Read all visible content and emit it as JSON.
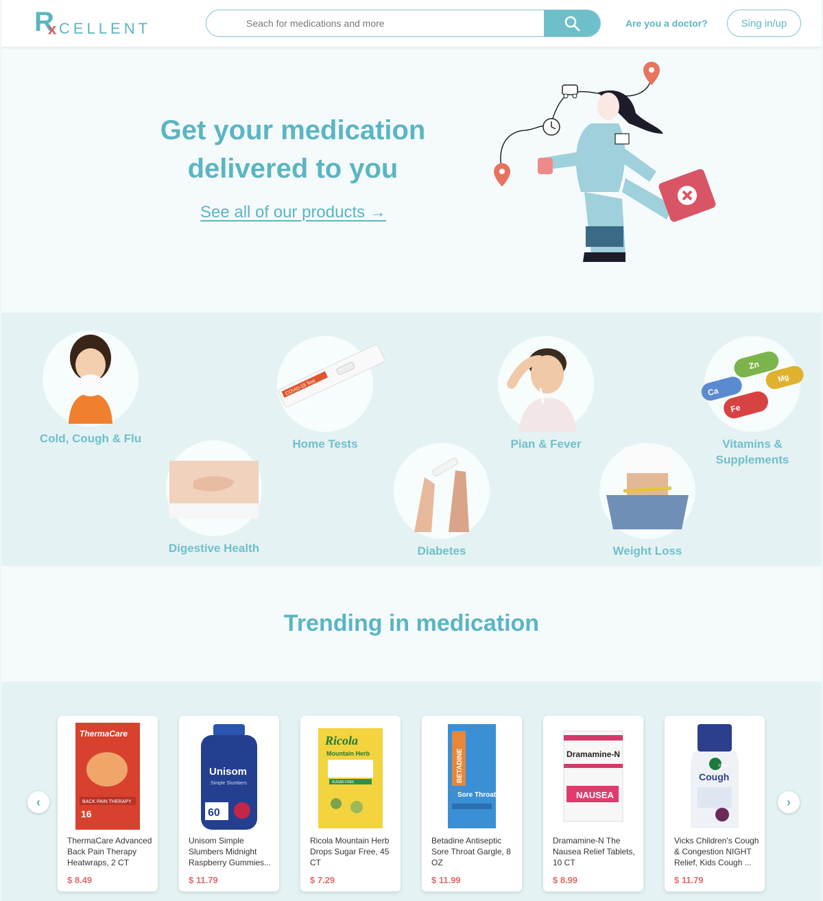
{
  "header": {
    "logo_r": "R",
    "logo_x": "x",
    "logo_rest": "CELLENT",
    "search_placeholder": "Seach for medications and more",
    "doctor_link": "Are you a doctor?",
    "signin_label": "Sing in/up"
  },
  "hero": {
    "title_line1": "Get your medication",
    "title_line2": "delivered to you",
    "cta": "See all of our products →"
  },
  "categories": [
    {
      "label": "Cold, Cough & Flu"
    },
    {
      "label": "Home Tests"
    },
    {
      "label": "Pian & Fever"
    },
    {
      "label": "Vitamins & Supplements"
    },
    {
      "label": "Digestive Health"
    },
    {
      "label": "Diabetes"
    },
    {
      "label": "Weight Loss"
    }
  ],
  "home_test_label": "COVID-19 Test",
  "vitamin_labels": [
    "Ca",
    "Zn",
    "Fe",
    "Mg"
  ],
  "trending": {
    "title": "Trending in medication",
    "products": [
      {
        "name": "ThermaCare Advanced Back Pain Therapy Heatwraps, 2 CT",
        "price": "$ 8.49",
        "brand": "ThermaCare",
        "sub": "BACK PAIN THERAPY",
        "count": "16"
      },
      {
        "name": "Unisom Simple Slumbers Midnight Raspberry Gummies...",
        "price": "$ 11.79",
        "brand": "Unisom",
        "sub": "Simple Slumbers",
        "count": "60"
      },
      {
        "name": "Ricola Mountain Herb Drops Sugar Free, 45 CT",
        "price": "$ 7.29",
        "brand": "Ricola",
        "sub": "Mountain Herb",
        "count": "SUGAR FREE"
      },
      {
        "name": "Betadine Antiseptic Sore Throat Gargle, 8 OZ",
        "price": "$ 11.99",
        "brand": "BETADINE",
        "sub": "Sore Throat",
        "count": ""
      },
      {
        "name": "Dramamine-N The Nausea Relief Tablets, 10 CT",
        "price": "$ 8.99",
        "brand": "Dramamine-N",
        "sub": "NAUSEA",
        "count": ""
      },
      {
        "name": "Vicks Children's Cough & Congestion NIGHT Relief, Kids Cough ...",
        "price": "$ 11.79",
        "brand": "Cough",
        "sub": "VICKS",
        "count": ""
      }
    ]
  },
  "colors": {
    "accent": "#5bb5c2",
    "price": "#e06b6b",
    "band": "#e4f2f3"
  }
}
